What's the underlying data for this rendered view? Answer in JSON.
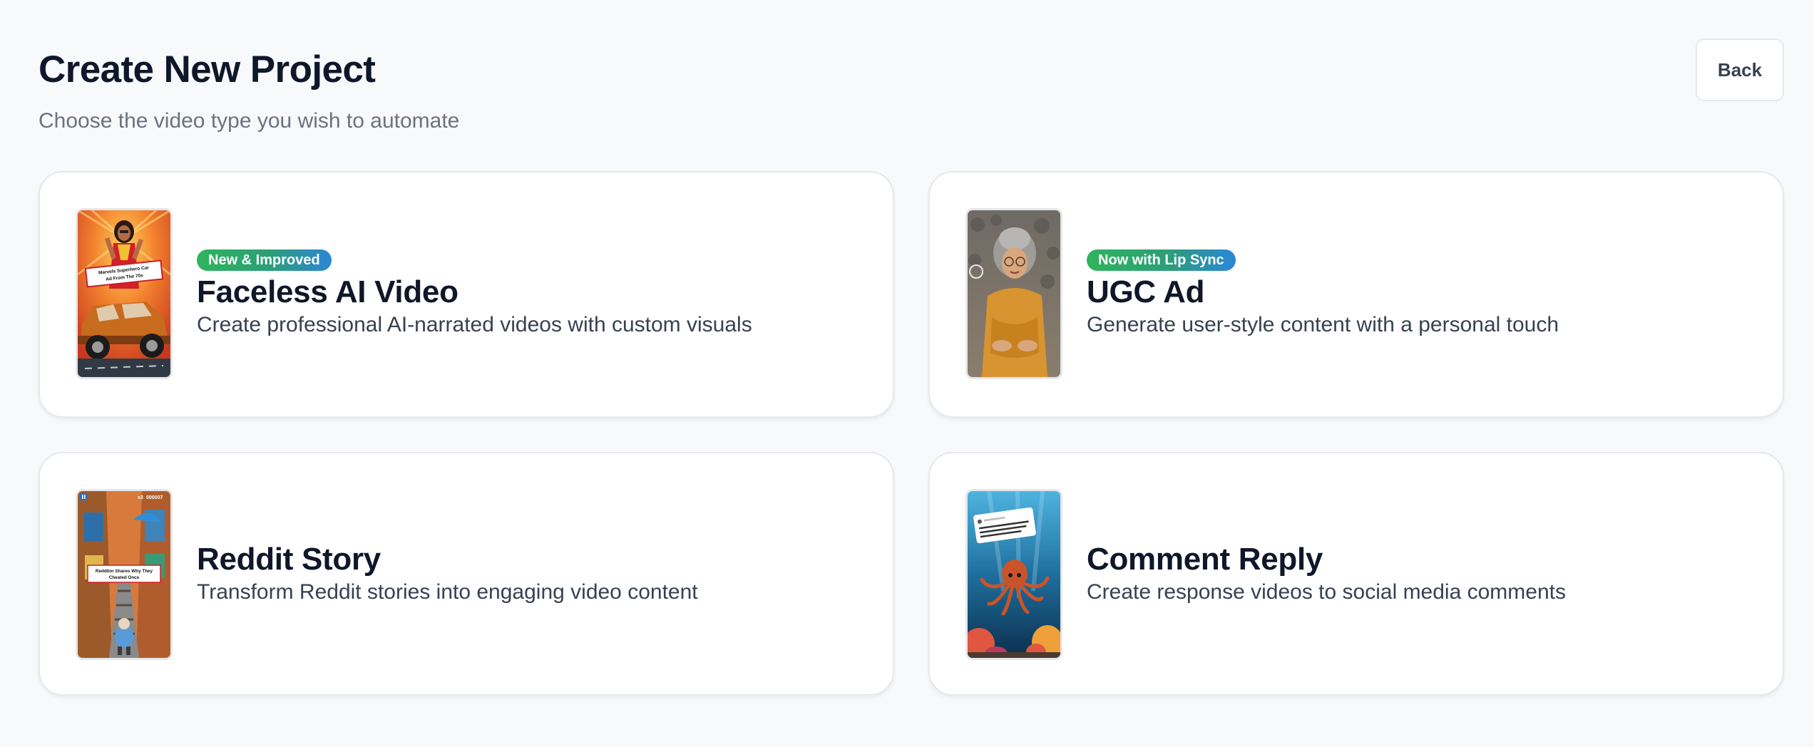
{
  "header": {
    "title": "Create New Project",
    "subtitle": "Choose the video type you wish to automate",
    "back_label": "Back"
  },
  "cards": [
    {
      "badge": "New & Improved",
      "title": "Faceless AI Video",
      "description": "Create professional AI-narrated videos with custom visuals",
      "thumbnail_caption": "Marvels Superhero Car Ad From The 70s"
    },
    {
      "badge": "Now with Lip Sync",
      "title": "UGC Ad",
      "description": "Generate user-style content with a personal touch"
    },
    {
      "title": "Reddit Story",
      "description": "Transform Reddit stories into engaging video content",
      "thumbnail_caption": "Redditor Shares Why They Cheated Once",
      "thumbnail_score": "000007",
      "thumbnail_multiplier": "x3"
    },
    {
      "title": "Comment Reply",
      "description": "Create response videos to social media comments"
    }
  ],
  "colors": {
    "background": "#f8f9fb",
    "card": "#ffffff",
    "badge_start": "#2fb45c",
    "badge_end": "#2b86d8",
    "title": "#0f172a",
    "muted": "#6b7280"
  }
}
